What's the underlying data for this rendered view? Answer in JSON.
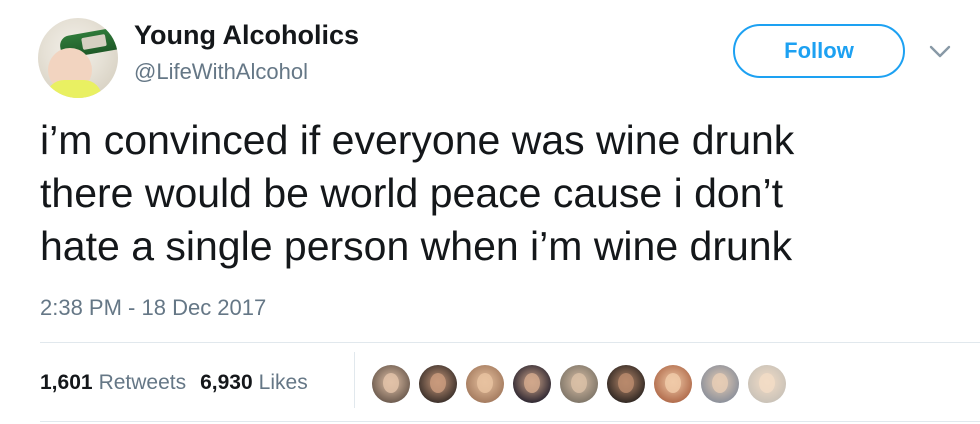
{
  "author": {
    "name": "Young Alcoholics",
    "handle": "@LifeWithAlcohol"
  },
  "follow_button": {
    "label": "Follow"
  },
  "menu": {
    "icon": "chevron-down-icon"
  },
  "tweet": {
    "lines": [
      "i’m convinced if everyone was wine drunk",
      "there would be world peace cause i don’t",
      "hate a single person when i’m wine drunk"
    ],
    "timestamp": "2:38 PM - 18 Dec 2017"
  },
  "stats": {
    "retweets_count": "1,601",
    "retweets_label": "Retweets",
    "likes_count": "6,930",
    "likes_label": "Likes"
  },
  "likers": [
    {
      "bg": "#6b5a4e",
      "face": "#e2c2a8"
    },
    {
      "bg": "#3a2f2a",
      "face": "#c99a7c"
    },
    {
      "bg": "#a37a5e",
      "face": "#e8c2a0"
    },
    {
      "bg": "#2b2530",
      "face": "#d1a88c"
    },
    {
      "bg": "#7e7568",
      "face": "#d9bfa6"
    },
    {
      "bg": "#2e2622",
      "face": "#b98a6c"
    },
    {
      "bg": "#b06a4a",
      "face": "#f0caa8"
    },
    {
      "bg": "#8a8f9a",
      "face": "#e6cdb5"
    },
    {
      "bg": "#c9c2b8",
      "face": "#f2dcc6"
    }
  ],
  "colors": {
    "accent": "#1da1f2",
    "text": "#14171a",
    "muted": "#657786",
    "divider": "#e1e8ed"
  }
}
